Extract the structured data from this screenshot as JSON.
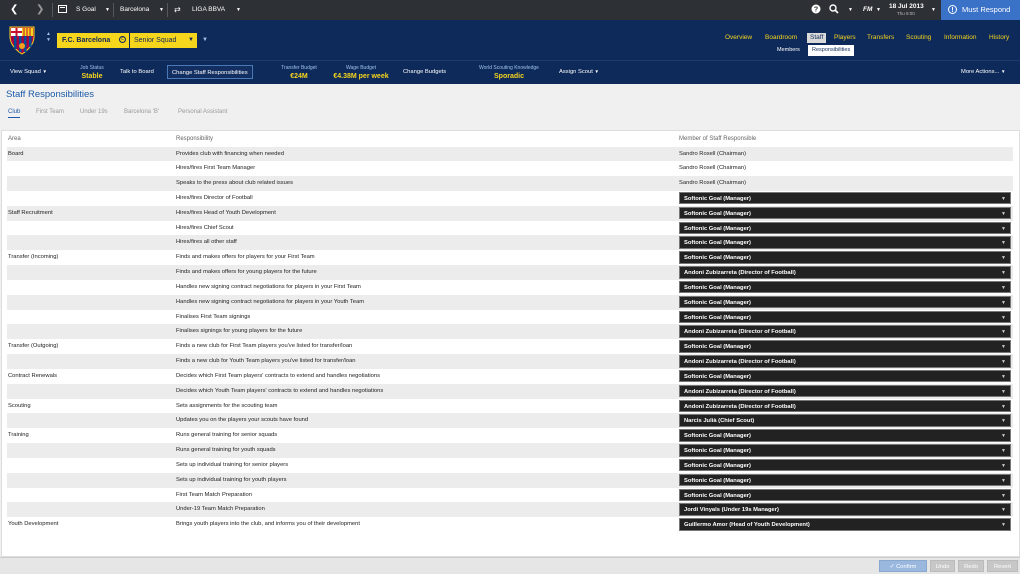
{
  "topbar": {
    "back_icon": "chevron-left-icon",
    "forward_icon": "chevron-right-icon",
    "manager_name": "S Goal",
    "club_name": "Barcelona",
    "league_name": "LIGA BBVA",
    "date": "18 Jul 2013",
    "day_time": "Thu 9:00",
    "fm_label": "FM",
    "continue_label": "Must Respond"
  },
  "header": {
    "club_label": "F.C. Barcelona",
    "squad_label": "Senior Squad",
    "menu": [
      "Overview",
      "Boardroom",
      "Staff",
      "Players",
      "Transfers",
      "Scouting",
      "Information",
      "History"
    ],
    "submenu": [
      "Members",
      "Responsibilities"
    ]
  },
  "toolbar": {
    "view_squad": "View Squad",
    "job_status_label": "Job Status",
    "job_status_value": "Stable",
    "talk_to_board": "Talk to Board",
    "change_staff_resp": "Change Staff Responsibilities",
    "transfer_budget_label": "Transfer Budget",
    "transfer_budget_value": "€24M",
    "wage_budget_label": "Wage Budget",
    "wage_budget_value": "€4.38M per week",
    "change_budgets": "Change Budgets",
    "scouting_label": "World Scouting Knowledge",
    "scouting_value": "Sporadic",
    "assign_scout": "Assign Scout",
    "more_actions": "More Actions..."
  },
  "page": {
    "title": "Staff Responsibilities",
    "tabs": [
      "Club",
      "First Team",
      "Under 19s",
      "Barcelona 'B'",
      "Personal Assistant"
    ]
  },
  "table": {
    "headers": [
      "Area",
      "Responsibility",
      "Member of Staff Responsible"
    ],
    "rows": [
      {
        "area": "Board",
        "resp": "Provides club with financing when needed",
        "member": "Sandro Rosell (Chairman)",
        "dd": false
      },
      {
        "area": "",
        "resp": "Hires/fires First Team Manager",
        "member": "Sandro Rosell (Chairman)",
        "dd": false
      },
      {
        "area": "",
        "resp": "Speaks to the press about club related issues",
        "member": "Sandro Rosell (Chairman)",
        "dd": false
      },
      {
        "area": "",
        "resp": "Hires/fires Director of Football",
        "member": "Softonic Goal (Manager)",
        "dd": true
      },
      {
        "area": "Staff Recruitment",
        "resp": "Hires/fires Head of Youth Development",
        "member": "Softonic Goal (Manager)",
        "dd": true
      },
      {
        "area": "",
        "resp": "Hires/fires Chief Scout",
        "member": "Softonic Goal (Manager)",
        "dd": true
      },
      {
        "area": "",
        "resp": "Hires/fires all other staff",
        "member": "Softonic Goal (Manager)",
        "dd": true
      },
      {
        "area": "Transfer (Incoming)",
        "resp": "Finds and makes offers for players for your First Team",
        "member": "Softonic Goal (Manager)",
        "dd": true
      },
      {
        "area": "",
        "resp": "Finds and makes offers for young players for the future",
        "member": "Andoni Zubizarreta (Director of Football)",
        "dd": true
      },
      {
        "area": "",
        "resp": "Handles new signing contract negotiations for players in your First Team",
        "member": "Softonic Goal (Manager)",
        "dd": true
      },
      {
        "area": "",
        "resp": "Handles new signing contract negotiations for players in your Youth Team",
        "member": "Softonic Goal (Manager)",
        "dd": true
      },
      {
        "area": "",
        "resp": "Finalises First Team signings",
        "member": "Softonic Goal (Manager)",
        "dd": true
      },
      {
        "area": "",
        "resp": "Finalises signings for young players for the future",
        "member": "Andoni Zubizarreta (Director of Football)",
        "dd": true
      },
      {
        "area": "Transfer (Outgoing)",
        "resp": "Finds a new club for First Team players you've listed for transfer/loan",
        "member": "Softonic Goal (Manager)",
        "dd": true
      },
      {
        "area": "",
        "resp": "Finds a new club for Youth Team players you've listed for transfer/loan",
        "member": "Andoni Zubizarreta (Director of Football)",
        "dd": true
      },
      {
        "area": "Contract Renewals",
        "resp": "Decides which First Team players' contracts to extend and handles negotiations",
        "member": "Softonic Goal (Manager)",
        "dd": true
      },
      {
        "area": "",
        "resp": "Decides which Youth Team players' contracts to extend and handles negotiations",
        "member": "Andoni Zubizarreta (Director of Football)",
        "dd": true
      },
      {
        "area": "Scouting",
        "resp": "Sets assignments for the scouting team",
        "member": "Andoni Zubizarreta (Director of Football)",
        "dd": true
      },
      {
        "area": "",
        "resp": "Updates you on the players your scouts have found",
        "member": "Narcis Julià (Chief Scout)",
        "dd": true
      },
      {
        "area": "Training",
        "resp": "Runs general training for senior squads",
        "member": "Softonic Goal (Manager)",
        "dd": true
      },
      {
        "area": "",
        "resp": "Runs general training for youth squads",
        "member": "Softonic Goal (Manager)",
        "dd": true
      },
      {
        "area": "",
        "resp": "Sets up individual training for senior players",
        "member": "Softonic Goal (Manager)",
        "dd": true
      },
      {
        "area": "",
        "resp": "Sets up individual training for youth players",
        "member": "Softonic Goal (Manager)",
        "dd": true
      },
      {
        "area": "",
        "resp": "First Team Match Preparation",
        "member": "Softonic Goal (Manager)",
        "dd": true
      },
      {
        "area": "",
        "resp": "Under-19 Team Match Preparation",
        "member": "Jordi Vinyals (Under 19s Manager)",
        "dd": true
      },
      {
        "area": "Youth Development",
        "resp": "Brings youth players into the club, and informs you of their development",
        "member": "Guillermo Amor (Head of Youth Development)",
        "dd": true
      }
    ]
  },
  "footer": {
    "confirm": "Confirm",
    "undo": "Undo",
    "redo": "Redo",
    "revert": "Revert"
  },
  "colors": {
    "navy": "#0e2a5a",
    "yellow": "#f6d51d",
    "accent_blue": "#1c5aa8",
    "alert_blue": "#3a72c8"
  }
}
